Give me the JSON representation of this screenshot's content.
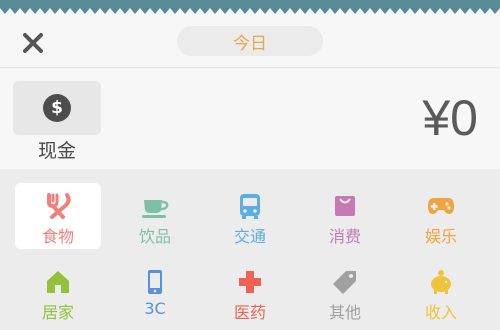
{
  "header": {
    "date_label": "今日"
  },
  "account": {
    "name": "现金",
    "icon": "dollar-coin-icon",
    "amount": "¥0"
  },
  "categories": [
    {
      "label": "食物",
      "icon": "fork-knife-icon",
      "color": "#ef7f7a",
      "selected": true
    },
    {
      "label": "饮品",
      "icon": "cup-icon",
      "color": "#7ec0a6",
      "selected": false
    },
    {
      "label": "交通",
      "icon": "bus-icon",
      "color": "#5aaee0",
      "selected": false
    },
    {
      "label": "消费",
      "icon": "shopping-bag-icon",
      "color": "#c679b3",
      "selected": false
    },
    {
      "label": "娱乐",
      "icon": "gamepad-icon",
      "color": "#f0a440",
      "selected": false
    },
    {
      "label": "居家",
      "icon": "house-icon",
      "color": "#94c13a",
      "selected": false
    },
    {
      "label": "3C",
      "icon": "phone-icon",
      "color": "#5a8fe0",
      "selected": false
    },
    {
      "label": "医药",
      "icon": "medical-cross-icon",
      "color": "#ee6255",
      "selected": false
    },
    {
      "label": "其他",
      "icon": "tag-icon",
      "color": "#a0a0a0",
      "selected": false
    },
    {
      "label": "收入",
      "icon": "piggy-bank-icon",
      "color": "#eec43c",
      "selected": false
    }
  ],
  "colors": {
    "accent": "#e7a64b",
    "wave": "#5a8a96"
  }
}
